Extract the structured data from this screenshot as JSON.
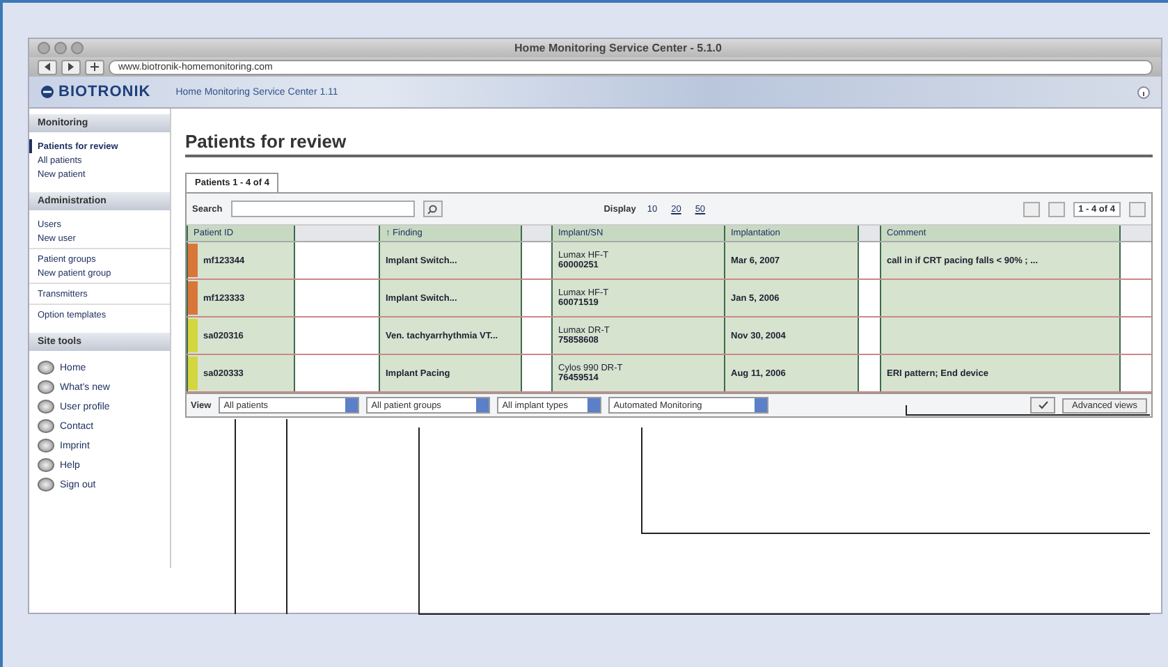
{
  "window": {
    "title": "Home Monitoring Service Center - 5.1.0",
    "url": "www.biotronik-homemonitoring.com"
  },
  "header": {
    "logo": "BIOTRONIK",
    "app_name": "Home Monitoring Service Center 1.11"
  },
  "sidebar": {
    "sections": [
      {
        "title": "Monitoring",
        "kind": "links",
        "groups": [
          {
            "items": [
              {
                "label": "Patients for review",
                "selected": true
              },
              {
                "label": "All patients",
                "selected": false
              },
              {
                "label": "New patient",
                "selected": false
              }
            ]
          }
        ]
      },
      {
        "title": "Administration",
        "kind": "links",
        "groups": [
          {
            "items": [
              {
                "label": "Users",
                "selected": false
              },
              {
                "label": "New user",
                "selected": false
              }
            ]
          },
          {
            "items": [
              {
                "label": "Patient groups",
                "selected": false
              },
              {
                "label": "New patient group",
                "selected": false
              }
            ]
          },
          {
            "items": [
              {
                "label": "Transmitters",
                "selected": false
              }
            ]
          },
          {
            "items": [
              {
                "label": "Option templates",
                "selected": false
              }
            ]
          }
        ]
      },
      {
        "title": "Site tools",
        "kind": "tools",
        "groups": [
          {
            "items": [
              {
                "label": "Home",
                "selected": false
              },
              {
                "label": "What's new",
                "selected": false
              },
              {
                "label": "User profile",
                "selected": false
              },
              {
                "label": "Contact",
                "selected": false
              },
              {
                "label": "Imprint",
                "selected": false
              },
              {
                "label": "Help",
                "selected": false
              },
              {
                "label": "Sign out",
                "selected": false
              }
            ]
          }
        ]
      }
    ]
  },
  "main": {
    "title": "Patients for review",
    "tabs": [
      {
        "label": "Patients 1 - 4 of 4",
        "selected": true
      }
    ],
    "toolbar": {
      "search_label": "Search",
      "display_label": "Display",
      "page_sizes": [
        {
          "label": "10",
          "selected": true
        },
        {
          "label": "20",
          "selected": false
        },
        {
          "label": "50",
          "selected": false
        }
      ],
      "pager": "1 - 4 of 4"
    },
    "table": {
      "columns": [
        {
          "kind": "patient_id",
          "label": "Patient ID",
          "highlighted": true
        },
        {
          "kind": "blank",
          "highlighted": false
        },
        {
          "kind": "finding",
          "label": "↑ Finding",
          "highlighted": true
        },
        {
          "kind": "blank",
          "highlighted": false
        },
        {
          "kind": "implant",
          "label": "Implant/SN",
          "highlighted": true
        },
        {
          "kind": "implantation",
          "label": "Implantation",
          "highlighted": true
        },
        {
          "kind": "blank",
          "highlighted": false
        },
        {
          "kind": "comment",
          "label": "Comment",
          "highlighted": true
        },
        {
          "kind": "blank",
          "highlighted": false
        }
      ],
      "rows": [
        {
          "color": "#d9773a",
          "patient_id": "mf123344",
          "finding": "Implant Switch...",
          "implant": "Lumax HF-T",
          "serial": "60000251",
          "implantation": "Mar 6, 2007",
          "comment": "call in if CRT pacing falls < 90% ; ..."
        },
        {
          "color": "#d9773a",
          "patient_id": "mf123333",
          "finding": "Implant Switch...",
          "implant": "Lumax HF-T",
          "serial": "60071519",
          "implantation": "Jan 5, 2006"
        },
        {
          "color": "#d4d640",
          "patient_id": "sa020316",
          "finding": "Ven. tachyarrhythmia VT...",
          "implant": "Lumax DR-T",
          "serial": "75858608",
          "implantation": "Nov 30, 2004"
        },
        {
          "color": "#d4d640",
          "patient_id": "sa020333",
          "finding": "Implant Pacing",
          "implant": "Cylos 990 DR-T",
          "serial": "76459514",
          "implantation": "Aug 11, 2006",
          "comment": "ERI pattern; End device"
        }
      ]
    },
    "filters": {
      "label": "View",
      "selects": [
        "All patients",
        "All patient groups",
        "All implant types",
        "Automated Monitoring"
      ],
      "advanced_button": "Advanced views"
    }
  }
}
